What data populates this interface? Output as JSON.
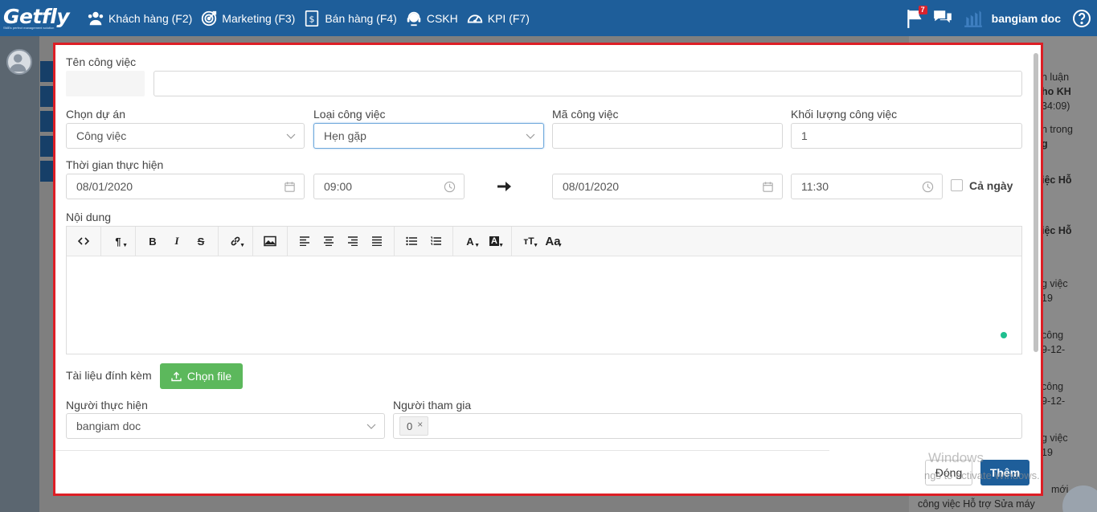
{
  "topbar": {
    "logo_text": "Getfly",
    "logo_sub": "SMEs perfect management solution",
    "nav": [
      {
        "label": "Khách hàng (F2)",
        "icon": "users-icon"
      },
      {
        "label": "Marketing (F3)",
        "icon": "target-icon"
      },
      {
        "label": "Bán hàng (F4)",
        "icon": "dollar-doc-icon"
      },
      {
        "label": "CSKH",
        "icon": "headset-icon"
      },
      {
        "label": "KPI (F7)",
        "icon": "speedometer-icon"
      }
    ],
    "flag_badge": "7",
    "user_name": "bangiam doc"
  },
  "background_feed": [
    {
      "text": "n luận"
    },
    {
      "text": "ho KH",
      "bold": true
    },
    {
      "text": "34:09)"
    },
    {
      "text": "n trong"
    },
    {
      "text": "g",
      "bold": true
    },
    {
      "text": "iệc Hỗ",
      "bold": true
    },
    {
      "text": "iệc Hỗ",
      "bold": true
    },
    {
      "text": "g việc"
    },
    {
      "text": "19"
    },
    {
      "text": "công"
    },
    {
      "text": "9-12-"
    },
    {
      "text": "công"
    },
    {
      "text": "9-12-"
    },
    {
      "text": "g việc"
    },
    {
      "text": "19"
    },
    {
      "text": "mới"
    },
    {
      "text": "công việc Hỗ trợ Sửa máy"
    }
  ],
  "form": {
    "task_name": {
      "label": "Tên công việc",
      "value": ""
    },
    "project": {
      "label": "Chọn dự án",
      "value": "Công việc"
    },
    "task_type": {
      "label": "Loại công việc",
      "value": "Hẹn gặp"
    },
    "task_code": {
      "label": "Mã công việc",
      "value": ""
    },
    "workload": {
      "label": "Khối lượng công việc",
      "value": "1"
    },
    "time": {
      "label": "Thời gian thực hiện",
      "start_date": "08/01/2020",
      "start_time": "09:00",
      "end_date": "08/01/2020",
      "end_time": "11:30",
      "all_day_label": "Cả ngày",
      "all_day_checked": false
    },
    "content": {
      "label": "Nội dung"
    },
    "attachments": {
      "label": "Tài liệu đính kèm",
      "button": "Chọn file"
    },
    "assignee": {
      "label": "Người thực hiện",
      "value": "bangiam doc"
    },
    "participants": {
      "label": "Người tham gia",
      "tags": [
        "0"
      ]
    }
  },
  "editor_toolbar": [
    "code",
    "paragraph",
    "bold",
    "italic",
    "strikethrough",
    "link",
    "image",
    "align-left",
    "align-center",
    "align-right",
    "justify",
    "unordered-list",
    "ordered-list",
    "font-color",
    "background-color",
    "font-size",
    "font-family"
  ],
  "footer": {
    "close_label": "Đóng",
    "add_label": "Thêm"
  },
  "watermark": {
    "line1": "Windows",
    "line2": "ngs to activate Windows."
  },
  "colors": {
    "navbar": "#1e5e9a",
    "primary_button": "#1e5e9a",
    "file_button": "#5cb85c",
    "highlight_frame": "#dd1e25"
  }
}
